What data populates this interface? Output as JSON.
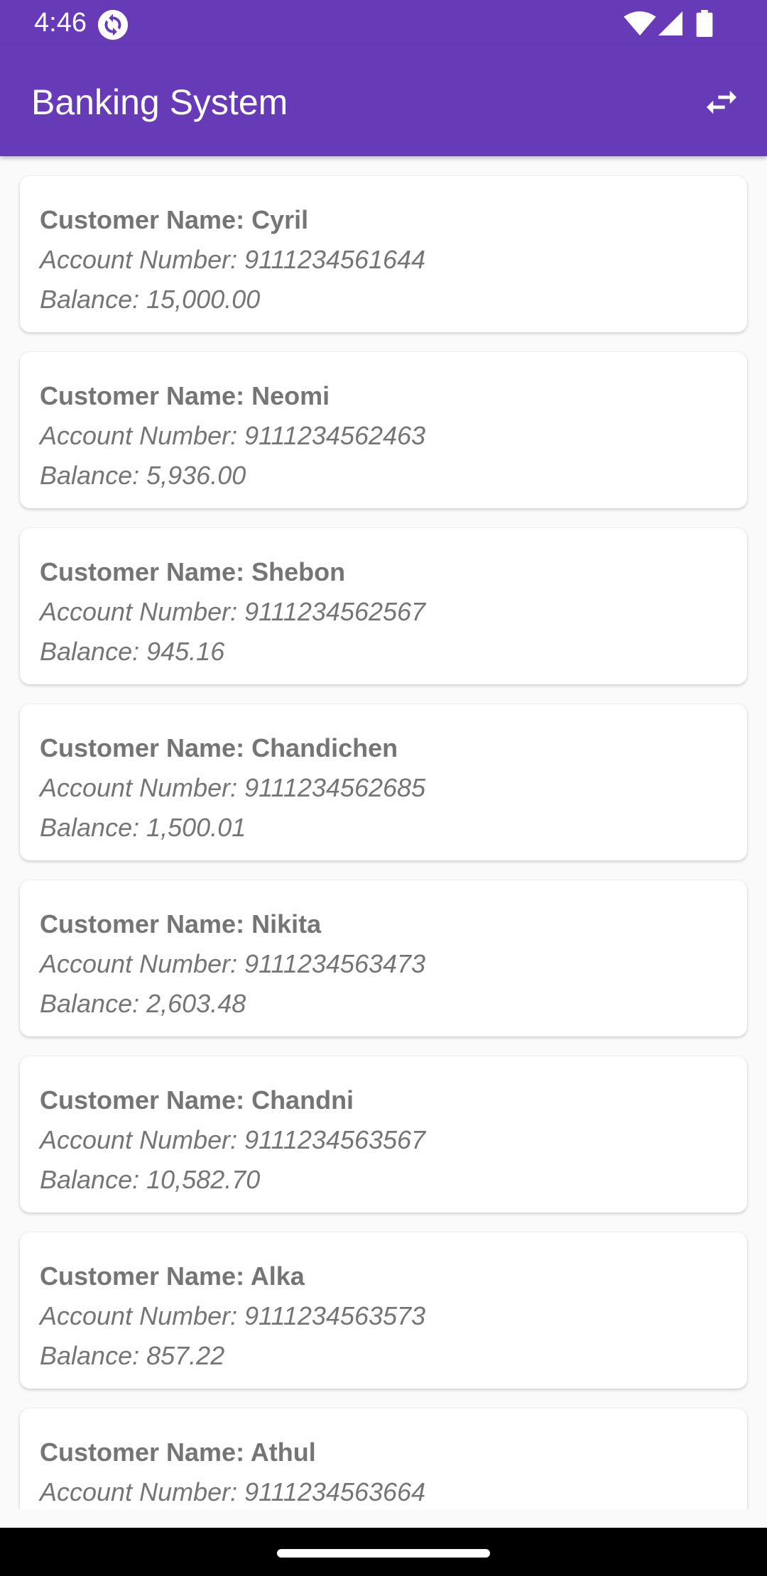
{
  "status_bar": {
    "time": "4:46"
  },
  "app_bar": {
    "title": "Banking System",
    "action_icon": "swap-horiz-icon"
  },
  "customers": [
    {
      "name": "Customer Name: Cyril",
      "account": "Account Number: 9111234561644",
      "balance": "Balance: 15,000.00"
    },
    {
      "name": "Customer Name: Neomi",
      "account": "Account Number: 9111234562463",
      "balance": "Balance: 5,936.00"
    },
    {
      "name": "Customer Name: Shebon",
      "account": "Account Number: 9111234562567",
      "balance": "Balance: 945.16"
    },
    {
      "name": "Customer Name: Chandichen",
      "account": "Account Number: 9111234562685",
      "balance": "Balance: 1,500.01"
    },
    {
      "name": "Customer Name: Nikita",
      "account": "Account Number: 9111234563473",
      "balance": "Balance: 2,603.48"
    },
    {
      "name": "Customer Name: Chandni",
      "account": "Account Number: 9111234563567",
      "balance": "Balance: 10,582.70"
    },
    {
      "name": "Customer Name: Alka",
      "account": "Account Number: 9111234563573",
      "balance": "Balance: 857.22"
    },
    {
      "name": "Customer Name: Athul",
      "account": "Account Number: 9111234563664",
      "balance": ""
    }
  ],
  "colors": {
    "primary": "#673ab7",
    "card_text": "#757575",
    "background": "#fafafa"
  }
}
